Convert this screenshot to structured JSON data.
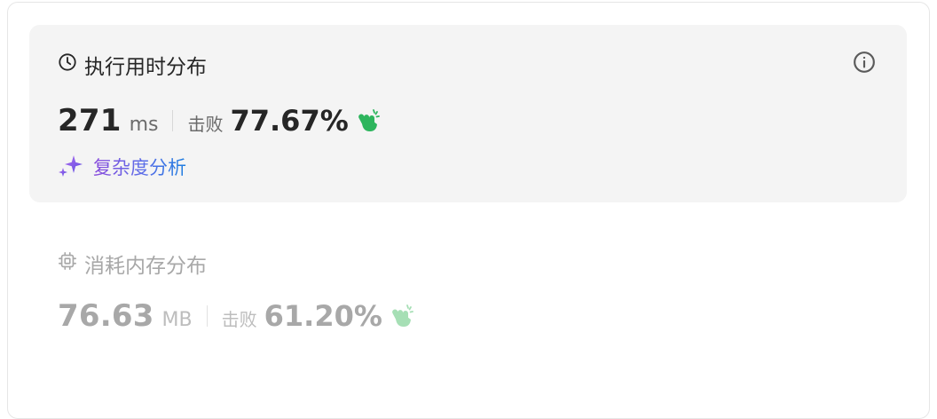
{
  "runtime": {
    "title": "执行用时分布",
    "value": "271",
    "unit": "ms",
    "beats_label": "击败",
    "beats_pct": "77.67%",
    "analysis_link": "复杂度分析"
  },
  "memory": {
    "title": "消耗内存分布",
    "value": "76.63",
    "unit": "MB",
    "beats_label": "击败",
    "beats_pct": "61.20%"
  },
  "icons": {
    "runtime": "clock-icon",
    "info": "info-icon",
    "clap_runtime": "clapping-hands-icon",
    "sparkle": "sparkle-icon",
    "memory": "chip-icon",
    "clap_memory": "clapping-hands-icon"
  },
  "colors": {
    "clap_active": "#2db55d",
    "clap_muted": "#a6dfb5",
    "ai_gradient_start": "#8a4bdc",
    "ai_gradient_end": "#1f7fe0",
    "card_bg": "#f4f4f4"
  }
}
